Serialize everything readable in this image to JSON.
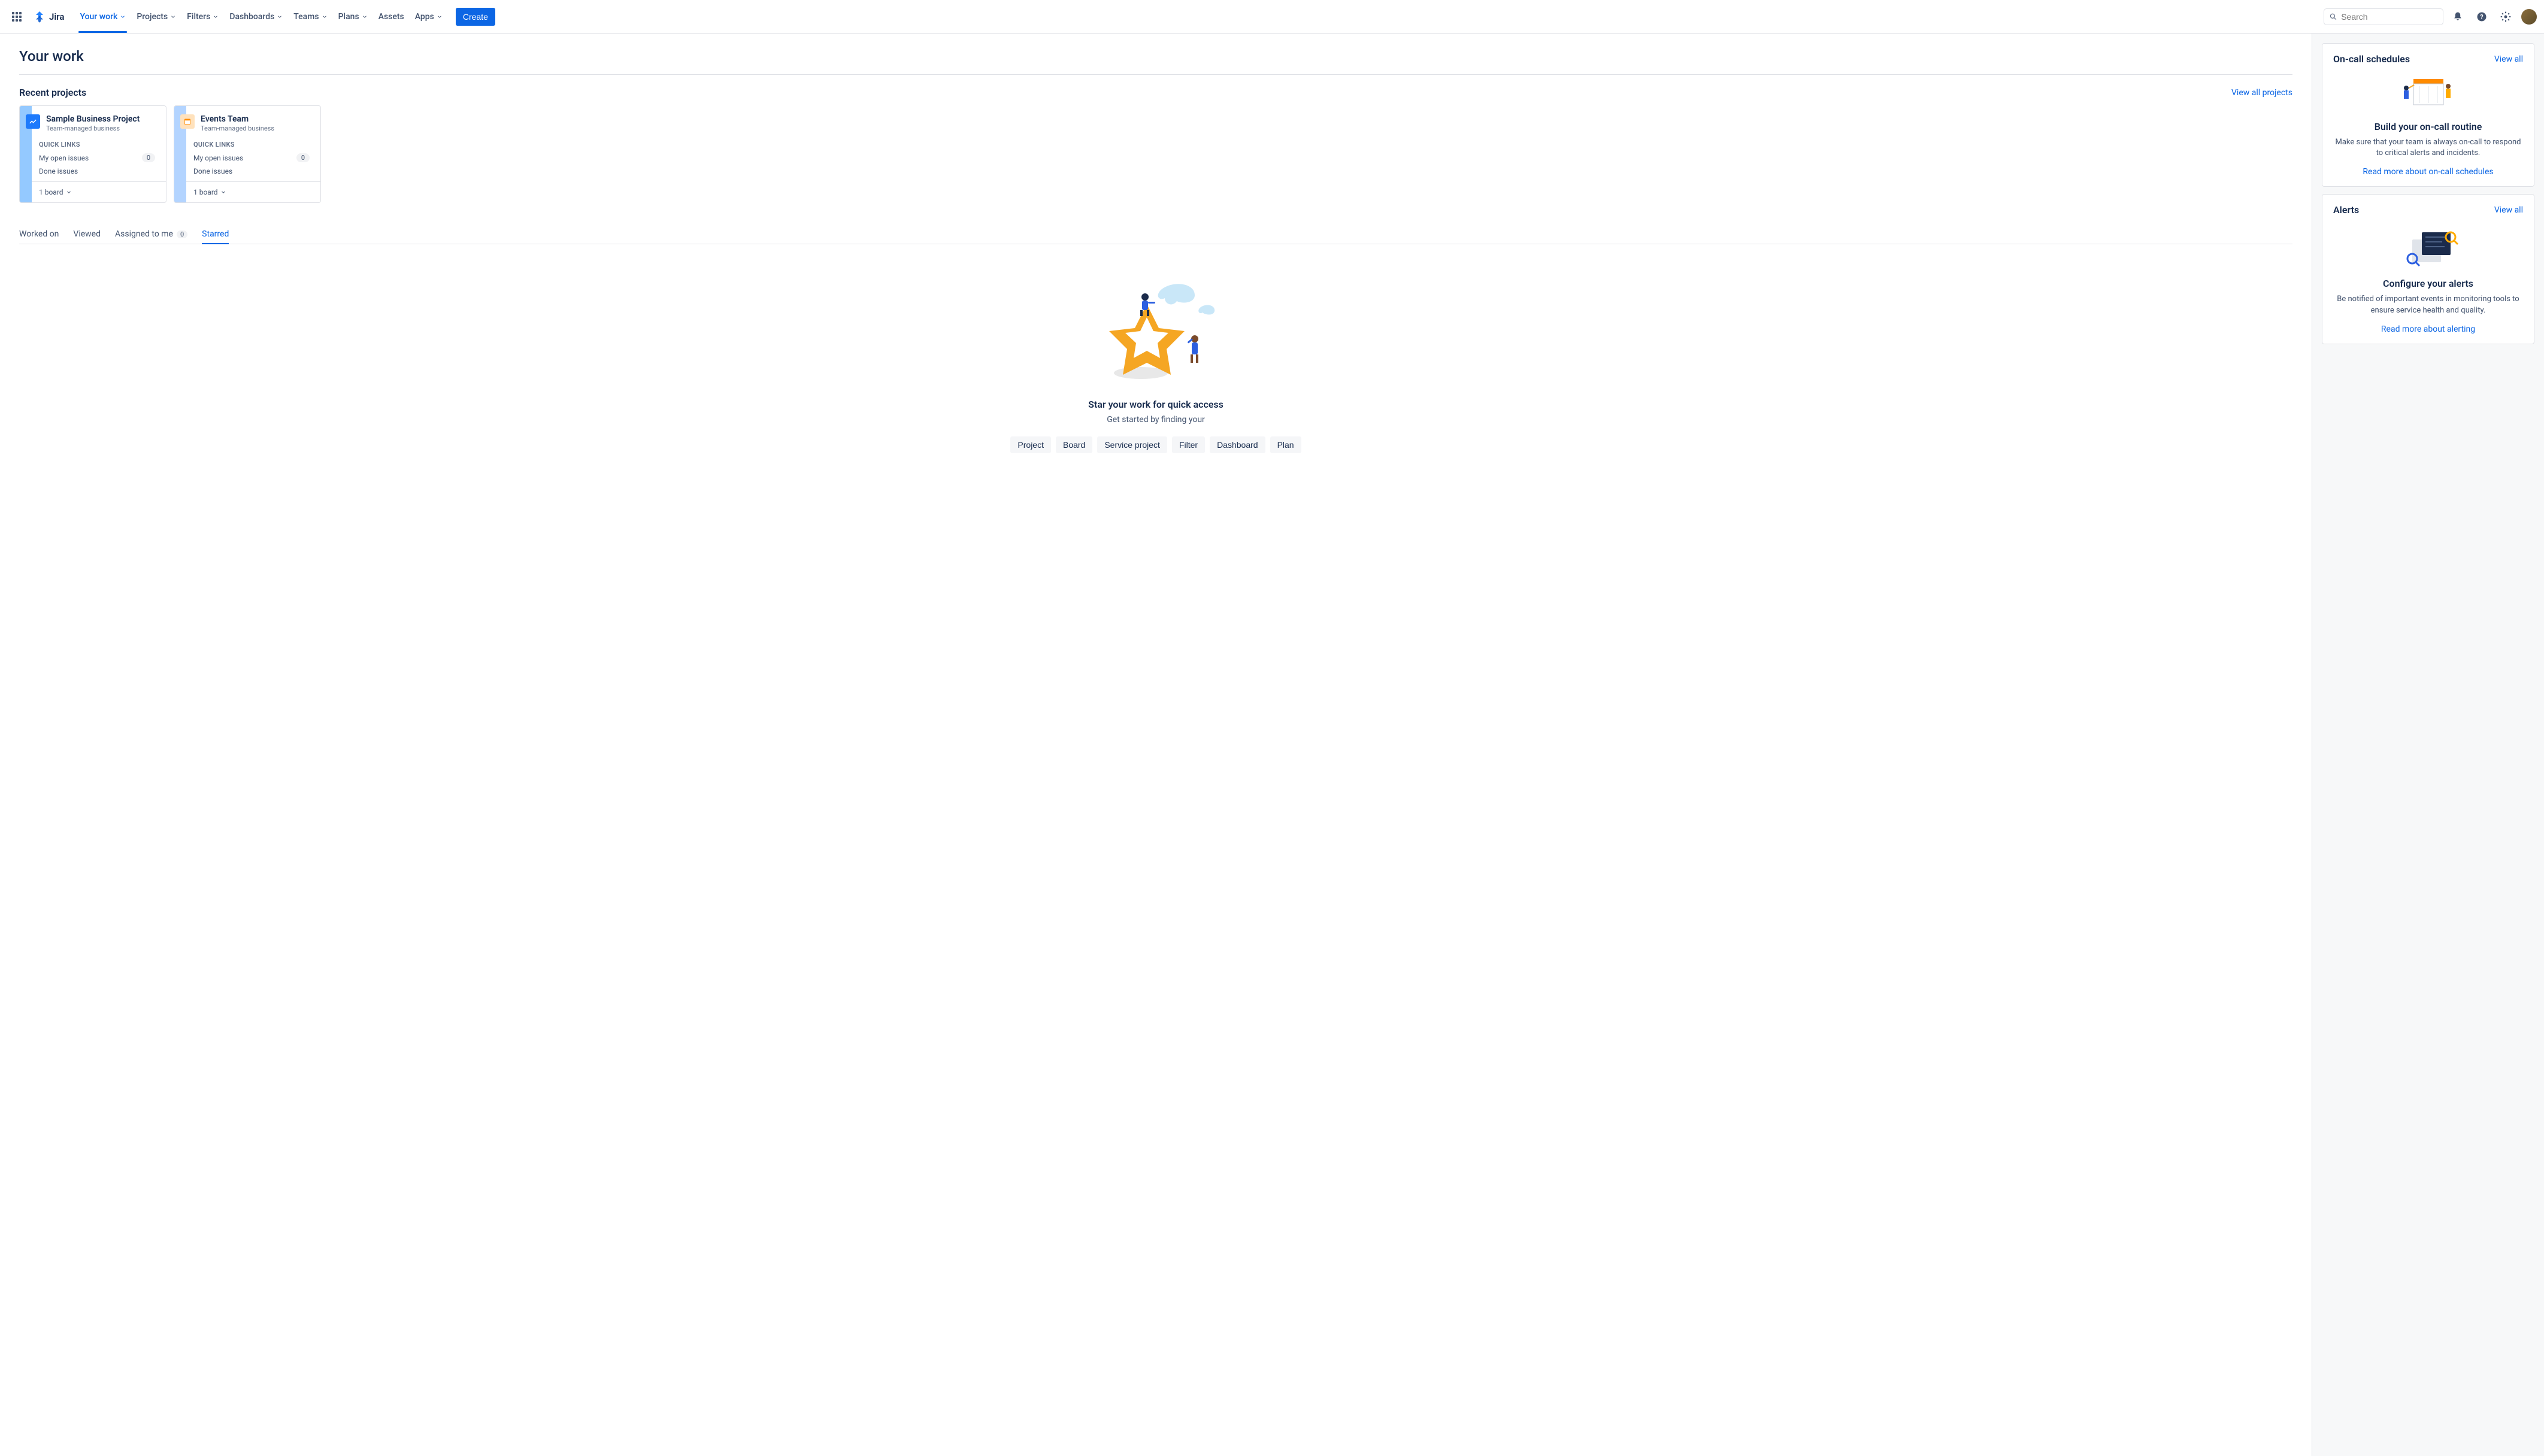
{
  "nav": {
    "logo": "Jira",
    "items": [
      "Your work",
      "Projects",
      "Filters",
      "Dashboards",
      "Teams",
      "Plans",
      "Assets",
      "Apps"
    ],
    "has_dropdown": [
      true,
      true,
      true,
      true,
      true,
      true,
      false,
      true
    ],
    "active_index": 0,
    "create": "Create",
    "search_placeholder": "Search"
  },
  "page": {
    "title": "Your work"
  },
  "recent": {
    "heading": "Recent projects",
    "view_all": "View all projects",
    "projects": [
      {
        "name": "Sample Business Project",
        "type": "Team-managed business",
        "quick_links_label": "QUICK LINKS",
        "links": [
          {
            "label": "My open issues",
            "count": "0"
          },
          {
            "label": "Done issues"
          }
        ],
        "board": "1 board"
      },
      {
        "name": "Events Team",
        "type": "Team-managed business",
        "quick_links_label": "QUICK LINKS",
        "links": [
          {
            "label": "My open issues",
            "count": "0"
          },
          {
            "label": "Done issues"
          }
        ],
        "board": "1 board"
      }
    ]
  },
  "tabs": {
    "items": [
      {
        "label": "Worked on"
      },
      {
        "label": "Viewed"
      },
      {
        "label": "Assigned to me",
        "count": "0"
      },
      {
        "label": "Starred"
      }
    ],
    "active_index": 3
  },
  "empty": {
    "title": "Star your work for quick access",
    "subtitle": "Get started by finding your",
    "chips": [
      "Project",
      "Board",
      "Service project",
      "Filter",
      "Dashboard",
      "Plan"
    ]
  },
  "sidebar": {
    "oncall": {
      "title": "On-call schedules",
      "view_all": "View all",
      "heading": "Build your on-call routine",
      "desc": "Make sure that your team is always on-call to respond to critical alerts and incidents.",
      "link": "Read more about on-call schedules"
    },
    "alerts": {
      "title": "Alerts",
      "view_all": "View all",
      "heading": "Configure your alerts",
      "desc": "Be notified of important events in monitoring tools to ensure service health and quality.",
      "link": "Read more about alerting"
    }
  }
}
